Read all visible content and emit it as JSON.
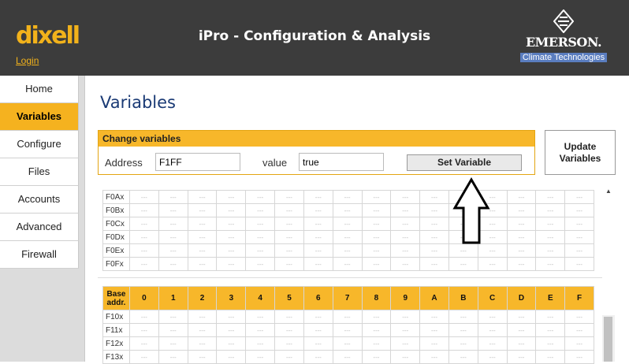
{
  "header": {
    "logo": "dixell",
    "login": "Login",
    "title": "iPro - Configuration & Analysis",
    "brand": "EMERSON.",
    "brand_sub": "Climate Technologies"
  },
  "sidebar": {
    "items": [
      {
        "label": "Home",
        "active": false
      },
      {
        "label": "Variables",
        "active": true
      },
      {
        "label": "Configure",
        "active": false
      },
      {
        "label": "Files",
        "active": false
      },
      {
        "label": "Accounts",
        "active": false
      },
      {
        "label": "Advanced",
        "active": false
      },
      {
        "label": "Firewall",
        "active": false
      }
    ]
  },
  "page": {
    "title": "Variables"
  },
  "change": {
    "header": "Change variables",
    "address_label": "Address",
    "address_value": "F1FF",
    "value_label": "value",
    "value_value": "true",
    "set_button": "Set Variable"
  },
  "update_button": "Update Variables",
  "grid1": {
    "rows": [
      "F0Ax",
      "F0Bx",
      "F0Cx",
      "F0Dx",
      "F0Ex",
      "F0Fx"
    ]
  },
  "grid2": {
    "base_header": "Base addr.",
    "columns": [
      "0",
      "1",
      "2",
      "3",
      "4",
      "5",
      "6",
      "7",
      "8",
      "9",
      "A",
      "B",
      "C",
      "D",
      "E",
      "F"
    ],
    "rows": [
      "F10x",
      "F11x",
      "F12x",
      "F13x"
    ]
  },
  "cell_placeholder": "---",
  "colors": {
    "accent": "#f5b21f",
    "header_bg": "#3c3c3c",
    "title": "#1a3a75"
  },
  "icons": {
    "annotation": "up-arrow-outline-icon"
  }
}
